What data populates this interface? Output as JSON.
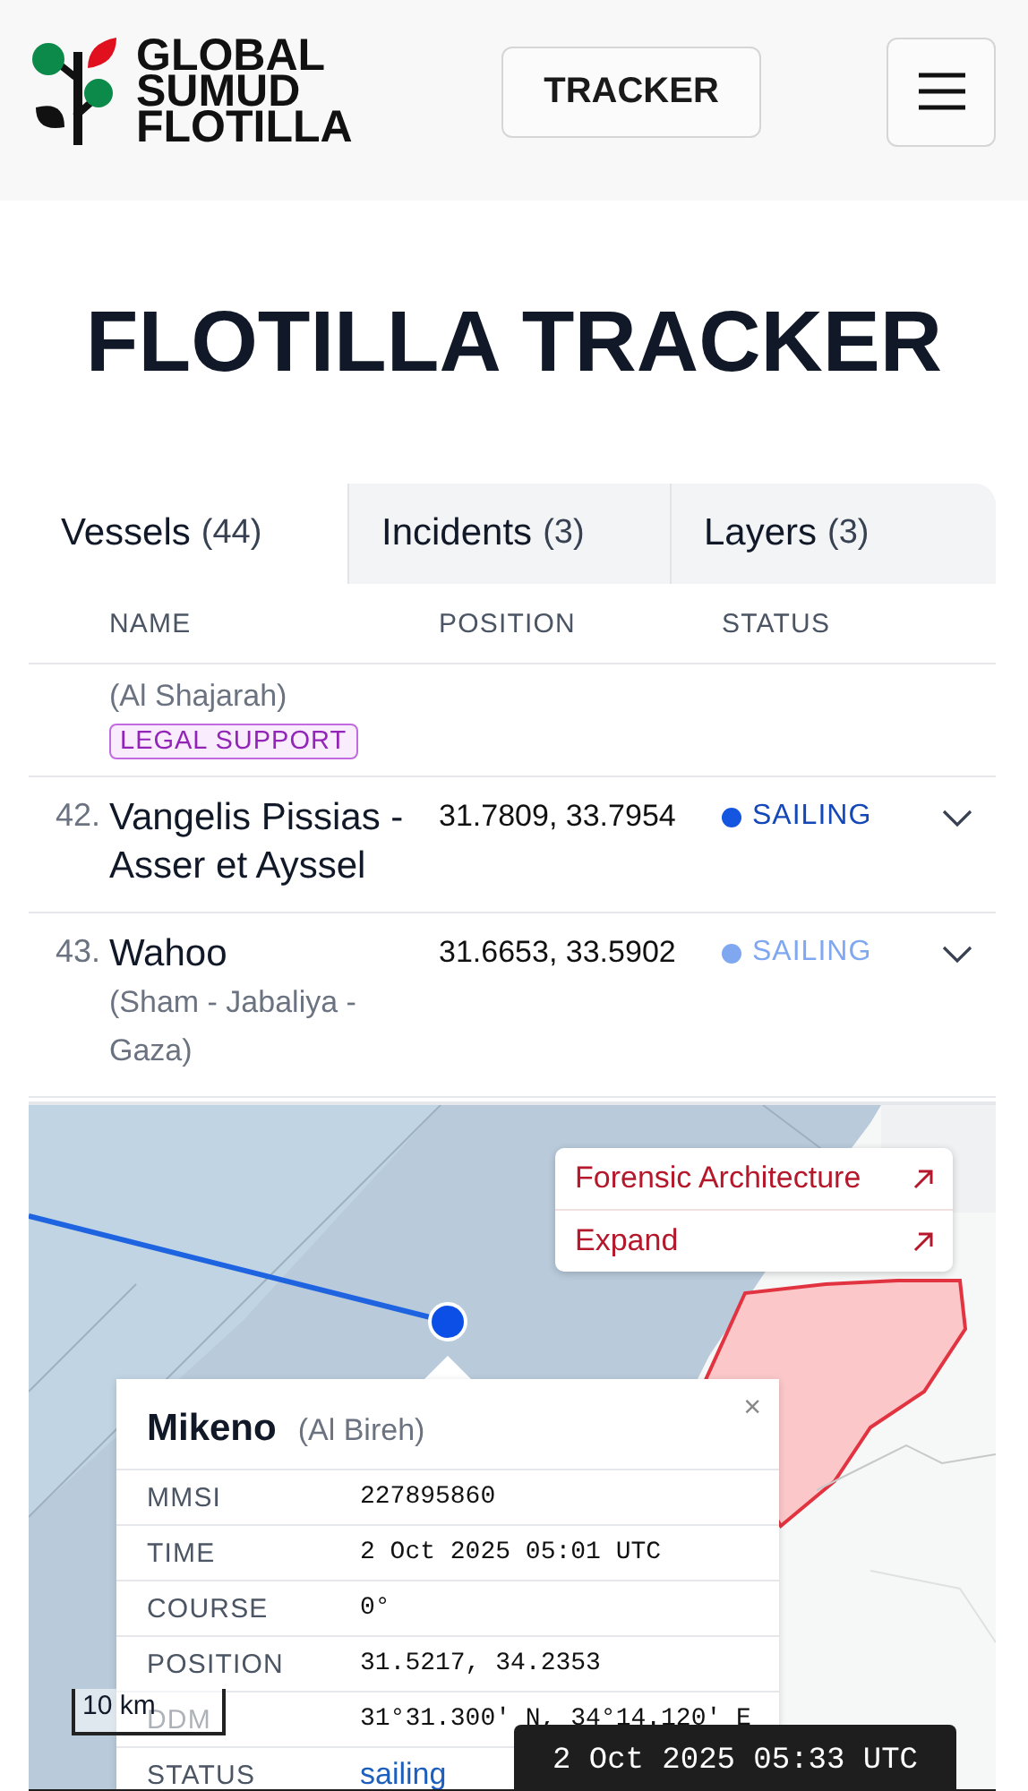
{
  "header": {
    "logo_lines": [
      "GLOBAL",
      "SUMUD",
      "FLOTILLA"
    ],
    "tracker_button": "TRACKER"
  },
  "title": "FLOTILLA TRACKER",
  "tabs": [
    {
      "label": "Vessels",
      "count": "(44)",
      "selected": true
    },
    {
      "label": "Incidents",
      "count": "(3)",
      "selected": false
    },
    {
      "label": "Layers",
      "count": "(3)",
      "selected": false
    }
  ],
  "table": {
    "columns": [
      "NAME",
      "POSITION",
      "STATUS"
    ],
    "rows": [
      {
        "subtitle": "(Al Shajarah)",
        "tag": "LEGAL SUPPORT"
      },
      {
        "number": "42.",
        "name": "Vangelis Pissias - Asser et Ayssel",
        "position": "31.7809, 33.7954",
        "status": "SAILING",
        "color": "#1456e0"
      },
      {
        "number": "43.",
        "name": "Wahoo",
        "subtitle": "(Sham - Jabaliya - Gaza)",
        "position": "31.6653, 33.5902",
        "status": "SAILING",
        "color": "#7fa8f0"
      }
    ]
  },
  "map": {
    "menu": [
      "Forensic Architecture",
      "Expand"
    ],
    "popup": {
      "name": "Mikeno",
      "subtitle": "(Al Bireh)",
      "close": "×",
      "fields": [
        {
          "label": "MMSI",
          "value": "227895860"
        },
        {
          "label": "TIME",
          "value": "2 Oct 2025 05:01 UTC"
        },
        {
          "label": "COURSE",
          "value": "0°"
        },
        {
          "label": "POSITION",
          "value": "31.5217, 34.2353"
        },
        {
          "label": "DDM",
          "value": "31°31.300' N, 34°14.120' E"
        },
        {
          "label": "STATUS",
          "value": "sailing",
          "kind": "link"
        }
      ]
    },
    "scale": "10 km",
    "clock": "2 Oct 2025 05:33 UTC"
  }
}
